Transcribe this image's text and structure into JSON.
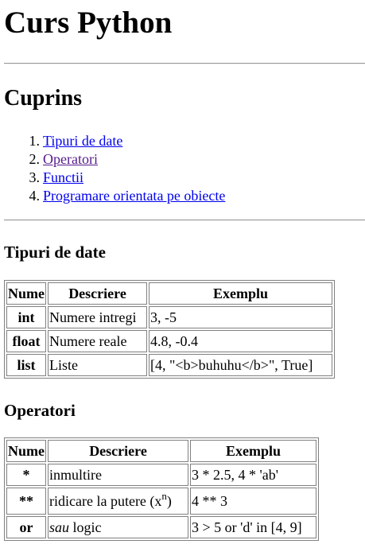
{
  "page": {
    "title": "Curs Python",
    "toc_heading": "Cuprins",
    "toc": [
      {
        "num": "1.",
        "label": "Tipuri de date"
      },
      {
        "num": "2.",
        "label": "Operatori"
      },
      {
        "num": "3.",
        "label": "Functii"
      },
      {
        "num": "4.",
        "label": "Programare orientata pe obiecte"
      }
    ]
  },
  "types_section": {
    "heading": "Tipuri de date",
    "headers": [
      "Nume",
      "Descriere",
      "Exemplu"
    ],
    "rows": [
      {
        "name": "int",
        "desc": "Numere intregi",
        "example": "3, -5"
      },
      {
        "name": "float",
        "desc": "Numere reale",
        "example": "4.8, -0.4"
      },
      {
        "name": "list",
        "desc": "Liste",
        "example": "[4, \"<b>buhuhu</b>\", True]"
      }
    ]
  },
  "operators_section": {
    "heading": "Operatori",
    "headers": [
      "Nume",
      "Descriere",
      "Exemplu"
    ],
    "rows": [
      {
        "name": "*",
        "desc": "inmultire",
        "example": "3 * 2.5, 4 * 'ab'"
      },
      {
        "name": "**",
        "desc": "ridicare la putere (x",
        "desc_sup": "n",
        "desc_end": ")",
        "example": "4 ** 3"
      },
      {
        "name": "or",
        "desc_em": "sau",
        "desc": " logic",
        "example": "3 > 5 or 'd' in [4, 9]"
      }
    ]
  },
  "colors": {
    "link": "#0000ee",
    "visited_link": "#551a8b",
    "border": "#808080"
  }
}
